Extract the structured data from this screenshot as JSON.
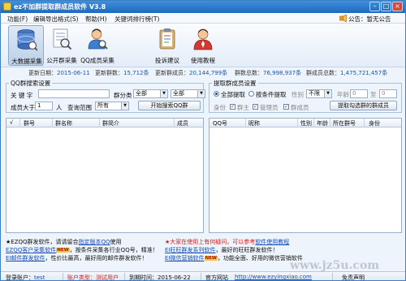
{
  "titlebar": {
    "title": "ez不加群提取群成员软件  V3.8",
    "minimize": "–",
    "maximize": "□",
    "close": "×"
  },
  "menu": {
    "items": [
      "功能(F)",
      "编辑导出格式(S)",
      "帮助(H)",
      "关键词排行榜(T)"
    ],
    "notice": "公告",
    "site": "官网",
    "login_status": "公告：暂无公告"
  },
  "toolbar": {
    "tools": [
      "大数据采集",
      "公开群采集",
      "QQ成员采集",
      "投诉建议",
      "使用教程"
    ]
  },
  "info": {
    "update_label": "更新日期：",
    "update_date": "2015-06-11",
    "groups_label": "更新群数：",
    "groups": "15,712条",
    "members_label": "更新群成员：",
    "members": "20,144,799条",
    "total_groups_label": "群数总数：",
    "total_groups": "76,998,937条",
    "total_members_label": "群成员总数：",
    "total_members": "1,475,721,457条"
  },
  "left_panel": {
    "title": "QQ群搜索设置",
    "keyword_label": "关 键 字",
    "keyword_value": "",
    "category_label": "群分类",
    "category_a": "全部",
    "category_b": "全部",
    "members_gt_label": "成员大于",
    "members_gt_value": "1",
    "members_unit": "人",
    "scope_label": "查询范围",
    "scope_value": "所有",
    "search_button": "开始搜索QQ群",
    "columns": [
      "√",
      "群号",
      "群名称",
      "群简介",
      "成员"
    ]
  },
  "right_panel": {
    "title": "提取群成员设置",
    "radio_all": "全部提取",
    "radio_condition": "按条件提取",
    "gender_label": "性别",
    "gender_value": "不限",
    "age_label": "年龄",
    "age_from": "0",
    "age_to_label": "至",
    "age_to": "0",
    "role_label": "身份",
    "role_owner": "群主",
    "role_admin": "管理员",
    "role_member": "群成员",
    "extract_button": "提取勾选群的群成员",
    "columns": [
      "QQ号",
      "昵称",
      "性别",
      "年龄",
      "所在群号",
      "身份"
    ]
  },
  "ads": {
    "left1_prefix": "★EZQQ群发软件，请请留合",
    "left1_link": "指定版本QQ",
    "left1_suffix": "使用",
    "left2_link": "EZQQ客户采集软件",
    "left2_text": "，按条件采集各行业QQ号，精准！",
    "left3_link": "EI邮件群发软件",
    "left3_text": "，性价比最高，最好用的邮件群发软件！",
    "right1_text": "★大家在使用上有何疑问，可以参考",
    "right1_link": "软件使用教程",
    "right2_link": "EI旺旺群发系列软件",
    "right2_text": "，最好的旺旺群发软件！",
    "right3_link": "EI微信营销软件",
    "right3_text": "，功能全面、好用的微信营销软件",
    "new_badge": "NEW"
  },
  "status": {
    "account_label": "登录账户：",
    "account": "test",
    "type_label": "账户类型：",
    "type": "测试用户",
    "expire_label": "到期时间：",
    "expire": "2015-06-22",
    "site_label": "官方网站",
    "site": "http://www.ezyingxiao.com",
    "disclaimer": "免责声明"
  },
  "watermark": "www.jz5u.com",
  "colors": {
    "titlebar": "#1d69bf",
    "accent": "#1a4fb8",
    "warning": "#d42020",
    "background": "#eef4fb"
  }
}
